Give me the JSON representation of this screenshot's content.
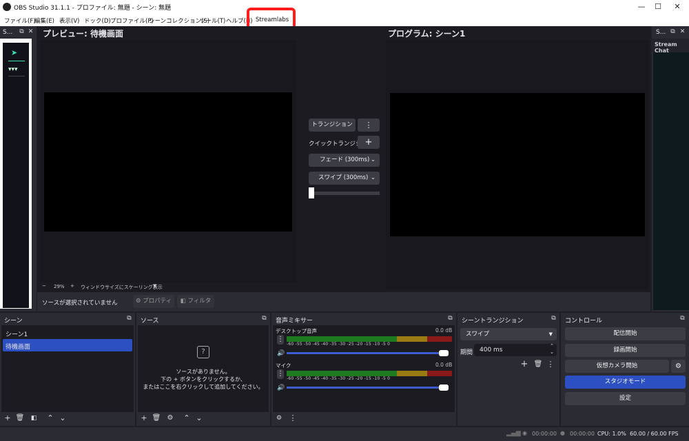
{
  "window": {
    "title": "OBS Studio 31.1.1 - プロファイル: 無題 - シーン: 無題",
    "minimize": "—",
    "maximize": "☐",
    "close": "✕"
  },
  "menu": [
    "ファイル(F)",
    "編集(E)",
    "表示(V)",
    "ドック(D)",
    "プロファイル(P)",
    "シーンコレクション(S)",
    "ツール(T)",
    "ヘルプ(H)",
    "Streamlabs"
  ],
  "left_dock": {
    "title": "S..."
  },
  "right_dock": {
    "title": "S...",
    "stream_chat": "Stream Chat"
  },
  "preview": {
    "title": "プレビュー: 待機画面",
    "zoom_minus": "−",
    "zoom": "29%",
    "zoom_plus": "+",
    "scale_mode": "ウィンドウサイズにスケーリング表示"
  },
  "program": {
    "title": "プログラム: シーン1"
  },
  "transition_panel": {
    "transition_button": "トランジション",
    "quick_transition_label": "クイックトランジション",
    "fade": "フェード (300ms)",
    "swipe": "スワイプ (300ms)"
  },
  "source_toolbar": {
    "no_source": "ソースが選択されていません",
    "properties": "プロパティ",
    "filters": "フィルタ"
  },
  "scenes": {
    "title": "シーン",
    "items": [
      "シーン1",
      "待機画面"
    ],
    "selected_index": 1
  },
  "sources": {
    "title": "ソース",
    "empty_line1": "ソースがありません。",
    "empty_line2": "下の + ボタンをクリックするか、",
    "empty_line3": "またはここを右クリックして追加してください。"
  },
  "mixer": {
    "title": "音声ミキサー",
    "channels": [
      {
        "name": "デスクトップ音声",
        "db": "0.0 dB",
        "volume": 1.0
      },
      {
        "name": "マイク",
        "db": "0.0 dB",
        "volume": 1.0
      }
    ],
    "ticks": "-60  -55  -50  -45  -40  -35  -30  -25  -20  -15  -10   -5   0"
  },
  "scene_transitions": {
    "title": "シーントランジション",
    "type": "スワイプ",
    "duration_label": "期間",
    "duration": "400 ms"
  },
  "controls": {
    "title": "コントロール",
    "start_streaming": "配信開始",
    "start_recording": "録画開始",
    "start_virtual_camera": "仮想カメラ開始",
    "studio_mode": "スタジオモード",
    "settings": "設定"
  },
  "status": {
    "stream_time": "00:00:00",
    "record_time": "00:00:00",
    "cpu": "CPU: 1.0%",
    "fps": "60.00 / 60.00 FPS"
  },
  "colors": {
    "accent": "#2c4fc2",
    "highlight": "#ff1e1e",
    "meter_green": "#1e7a1e",
    "meter_yellow": "#9a7a12",
    "meter_red": "#8a1a1a"
  }
}
